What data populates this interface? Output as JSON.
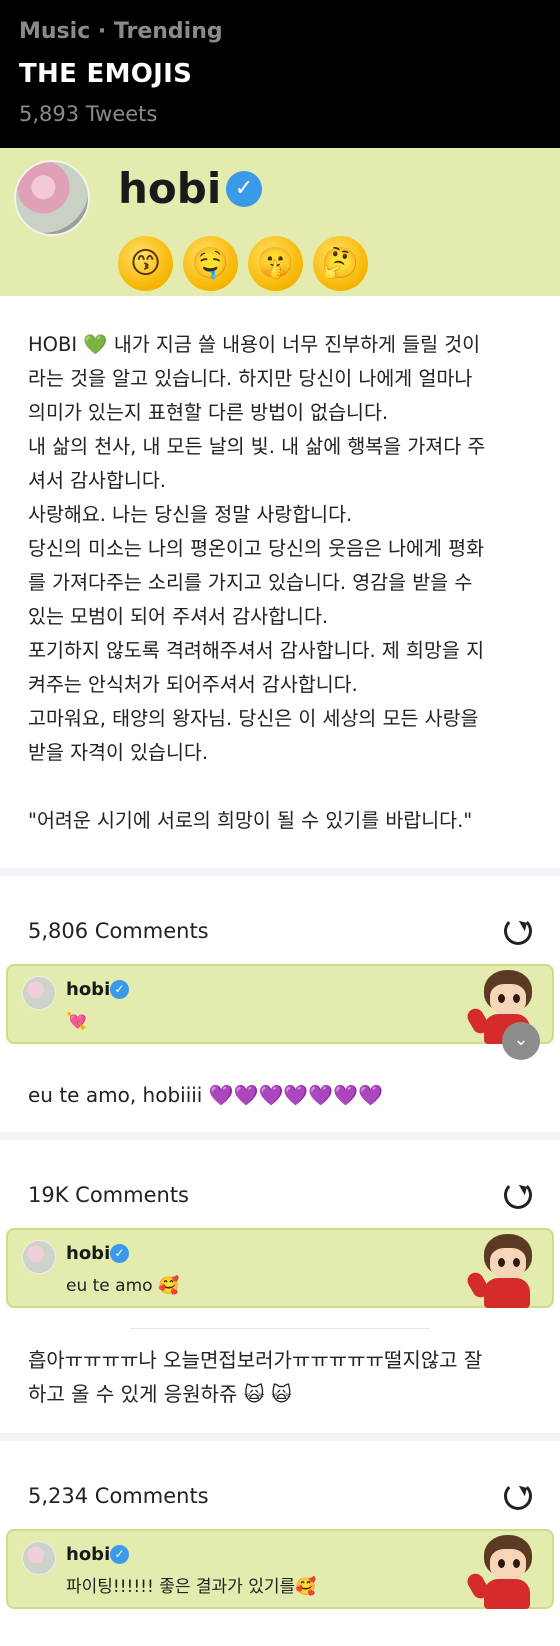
{
  "header": {
    "category": "Music · Trending",
    "title": "THE EMOJIS",
    "tweet_count": "5,893 Tweets"
  },
  "profile": {
    "name": "hobi",
    "emojis": [
      "😙",
      "🤤",
      "🤫",
      "🤔"
    ]
  },
  "post": {
    "text": "HOBI 💚 내가 지금 쓸 내용이 너무 진부하게 들릴 것이\n라는 것을 알고 있습니다. 하지만 당신이 나에게 얼마나\n의미가 있는지 표현할 다른 방법이 없습니다.\n내 삶의 천사, 내 모든 날의 빛. 내 삶에 행복을 가져다 주\n셔서 감사합니다.\n사랑해요. 나는 당신을 정말 사랑합니다.\n당신의 미소는 나의 평온이고 당신의 웃음은 나에게 평화\n를 가져다주는 소리를 가지고 있습니다.  영감을 받을 수\n있는 모범이 되어 주셔서 감사합니다.\n포기하지 않도록 격려해주셔서 감사합니다. 제 희망을 지\n켜주는 안식처가 되어주셔서 감사합니다.\n고마워요, 태양의 왕자님. 당신은 이 세상의 모든 사랑을\n받을 자격이 있습니다.\n\n\"어려운 시기에 서로의 희망이 될 수 있기를 바랍니다.\""
  },
  "threads": [
    {
      "count": "5,806 Comments",
      "reply_name": "hobi",
      "reply_text": "💘",
      "comment": "eu te amo, hobiiii 💜💜💜💜💜💜💜",
      "scroll_icon": "⌄"
    },
    {
      "count": "19K Comments",
      "reply_name": "hobi",
      "reply_text": "eu te amo 🥰",
      "comment": "흡아ㅠㅠㅠㅠ나 오늘면접보러가ㅠㅠㅠㅠㅠ떨지않고 잘\n하고 올 수 있게 응원하쥬 🙀 🙀"
    },
    {
      "count": "5,234 Comments",
      "reply_name": "hobi",
      "reply_text": "파이팅!!!!!! 좋은 결과가 있기를🥰"
    }
  ],
  "icons": {
    "verified": "✓"
  }
}
